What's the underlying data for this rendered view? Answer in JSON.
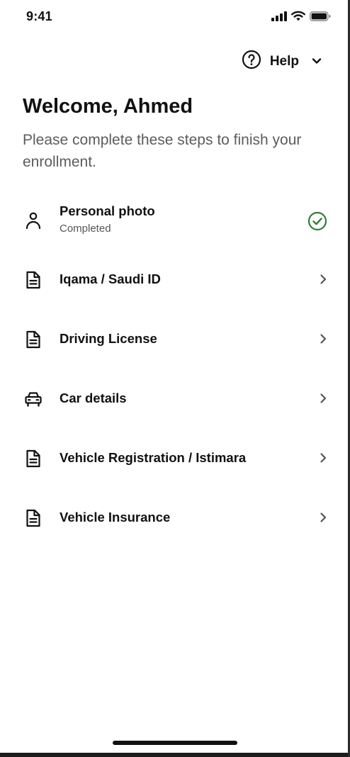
{
  "status_bar": {
    "time": "9:41",
    "icons": [
      "cellular-signal-icon",
      "wifi-icon",
      "battery-icon"
    ]
  },
  "header": {
    "help_label": "Help",
    "help_icon": "question-circle-icon",
    "dropdown_icon": "chevron-down-icon"
  },
  "welcome": {
    "title": "Welcome, Ahmed",
    "subtitle": "Please complete these steps to finish your enrollment."
  },
  "steps": [
    {
      "label": "Personal photo",
      "status": "Completed",
      "icon": "person-icon",
      "trailing_icon": "check-circle-icon"
    },
    {
      "label": "Iqama / Saudi ID",
      "icon": "document-icon",
      "trailing_icon": "chevron-right-icon"
    },
    {
      "label": "Driving License",
      "icon": "document-icon",
      "trailing_icon": "chevron-right-icon"
    },
    {
      "label": "Car details",
      "icon": "car-icon",
      "trailing_icon": "chevron-right-icon"
    },
    {
      "label": "Vehicle Registration / Istimara",
      "icon": "document-icon",
      "trailing_icon": "chevron-right-icon"
    },
    {
      "label": "Vehicle Insurance",
      "icon": "document-icon",
      "trailing_icon": "chevron-right-icon"
    }
  ],
  "colors": {
    "text_primary": "#111111",
    "text_secondary": "#5c5c5c",
    "success_green": "#2f7d3a",
    "background": "#ffffff"
  }
}
